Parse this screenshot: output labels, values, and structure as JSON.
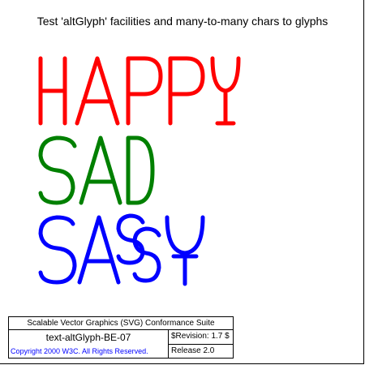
{
  "header": {
    "title": "Test 'altGlyph' facilities and many-to-many chars to glyphs"
  },
  "words": [
    {
      "text": "HAPPY",
      "color": "#ff0000"
    },
    {
      "text": "SAD",
      "color": "#008000"
    },
    {
      "text": "SASSY",
      "color": "#0000ff"
    }
  ],
  "footer": {
    "suite": "Scalable Vector Graphics (SVG) Conformance Suite",
    "test_name": "text-altGlyph-BE-07",
    "revision": "$Revision: 1.7 $",
    "copyright": "Copyright 2000 W3C. All Rights Reserved.",
    "release": "Release 2.0"
  }
}
